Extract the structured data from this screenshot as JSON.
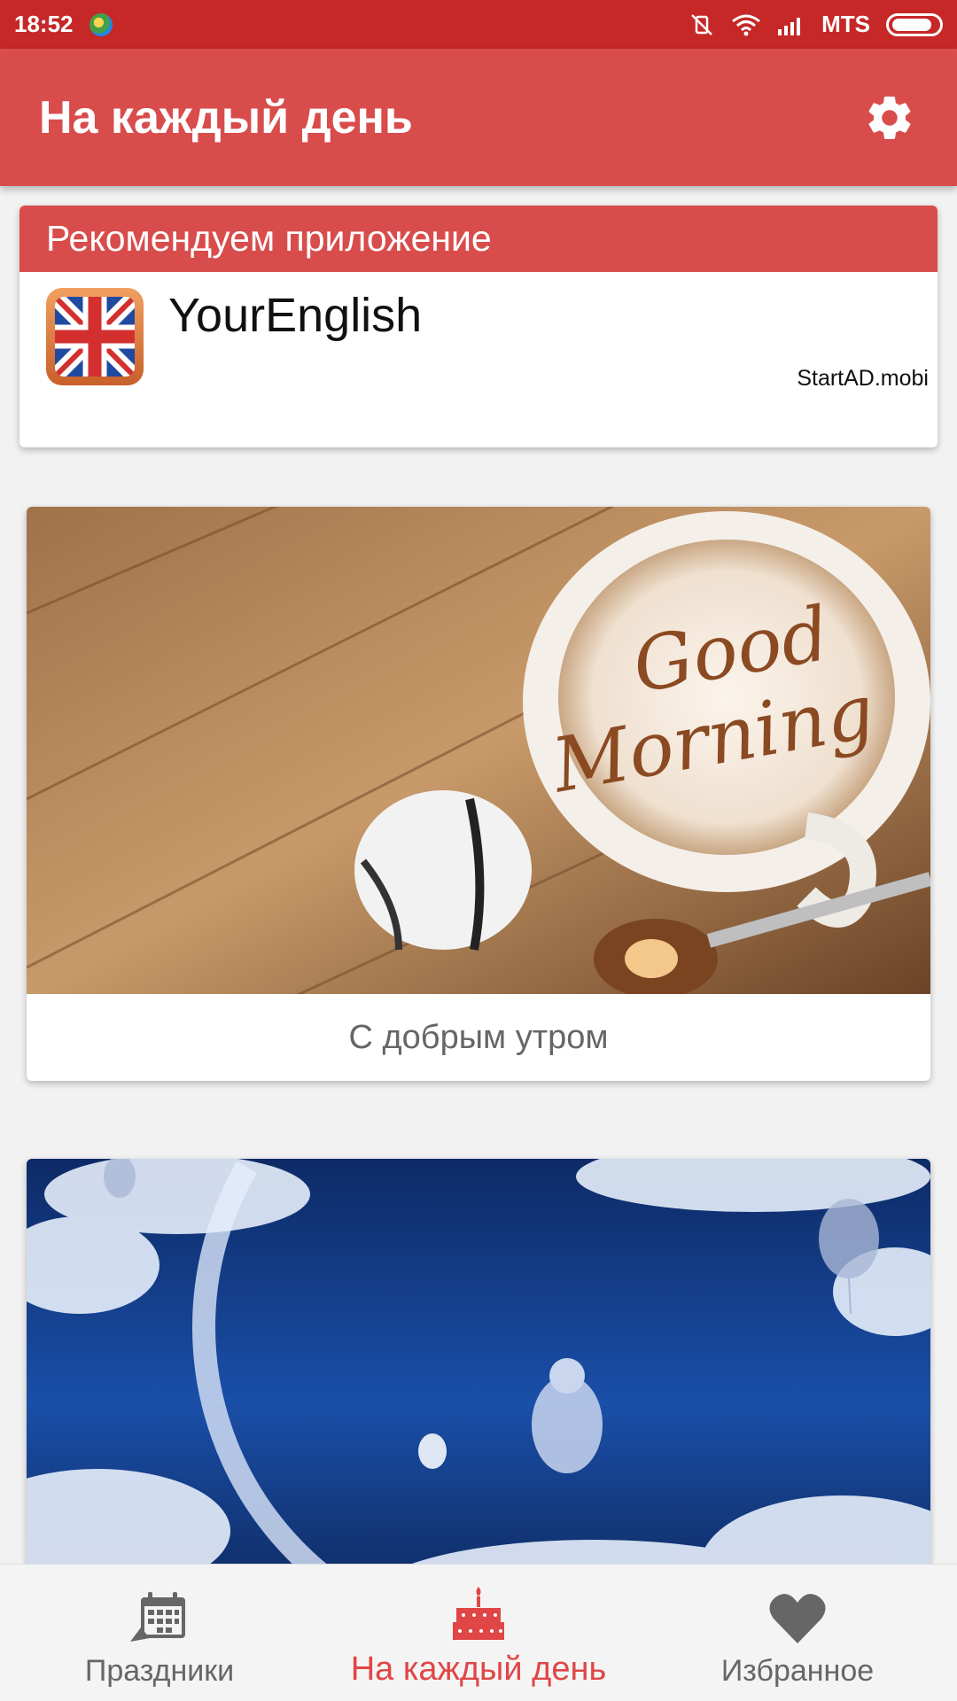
{
  "status_bar": {
    "time": "18:52",
    "carrier": "MTS"
  },
  "app_bar": {
    "title": "На каждый день"
  },
  "ad": {
    "header": "Рекомендуем приложение",
    "app_name": "YourEnglish",
    "source": "StartAD.mobi"
  },
  "cards": [
    {
      "caption": "С добрым утром",
      "image_text_line1": "Good",
      "image_text_line2": "Morning"
    },
    {
      "caption": ""
    }
  ],
  "bottom_nav": {
    "items": [
      {
        "label": "Праздники",
        "icon": "calendar-icon"
      },
      {
        "label": "На каждый день",
        "icon": "cake-icon",
        "active": true
      },
      {
        "label": "Избранное",
        "icon": "heart-icon"
      }
    ]
  },
  "colors": {
    "status_bar": "#c62828",
    "app_bar": "#d94c4c",
    "accent": "#e04646"
  }
}
